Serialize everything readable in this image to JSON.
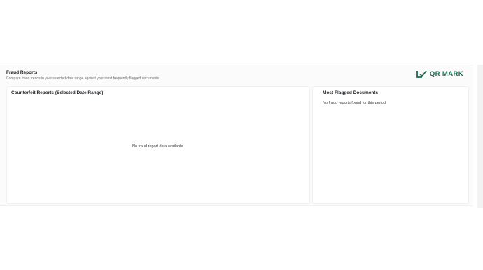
{
  "header": {
    "title": "Fraud Reports",
    "subtitle": "Compare fraud trends in your selected date range against your most frequently flagged documents"
  },
  "logo": {
    "text": "QR MARK",
    "icon": "check-mark-logo-icon",
    "color": "#1e6a4f"
  },
  "counterfeit_card": {
    "title": "Counterfeit Reports (Selected Date Range)",
    "empty_message": "No fraud report data available."
  },
  "flagged_card": {
    "title": "Most Flagged Documents",
    "empty_message": "No fraud reports found for this period."
  }
}
